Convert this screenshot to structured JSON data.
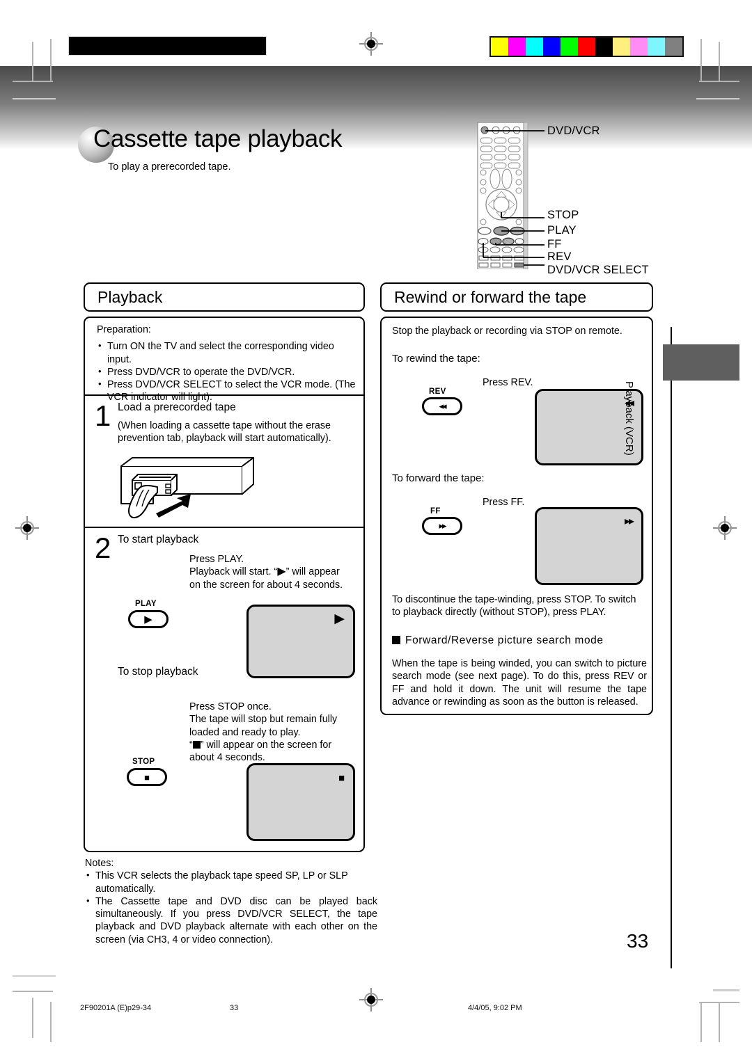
{
  "page": {
    "number": "33",
    "side_tab": "Playback (VCR)",
    "footer_left": "2F90201A (E)p29-34",
    "footer_center": "33",
    "footer_right": "4/4/05, 9:02 PM"
  },
  "heading": {
    "title": "Cassette tape playback",
    "subtitle": "To play a prerecorded tape."
  },
  "remote": {
    "callouts": [
      "DVD/VCR",
      "STOP",
      "PLAY",
      "FF",
      "REV",
      "DVD/VCR SELECT"
    ]
  },
  "playback": {
    "header": "Playback",
    "preparation_label": "Preparation:",
    "preparation_items": [
      "Turn ON the TV and select the corresponding video input.",
      "Press DVD/VCR to operate the DVD/VCR.",
      "Press DVD/VCR SELECT to select the VCR mode. (The VCR indicator will light)."
    ],
    "step1": {
      "num": "1",
      "title": "Load a prerecorded tape",
      "body": "(When loading a cassette tape without the erase prevention tab, playback will start automatically)."
    },
    "step2": {
      "num": "2",
      "title": "To start playback",
      "line1": "Press PLAY.",
      "line2a": "Playback will start. “",
      "line2icon": "▶",
      "line2b": "” will appear",
      "line3": "on the screen for about 4 seconds.",
      "button_label": "PLAY",
      "button_icon": "▶",
      "screen_icon": "▶"
    },
    "stop": {
      "title": "To stop playback",
      "line1": "Press STOP once.",
      "line2": "The tape will stop but remain fully",
      "line3": "loaded and ready to play.",
      "line4a": "“",
      "line4b": "” will appear on the screen for",
      "line5": "about 4 seconds.",
      "button_label": "STOP",
      "button_icon": "■",
      "screen_icon": "■"
    },
    "notes_label": "Notes:",
    "notes": [
      "This VCR selects the playback tape speed SP, LP or SLP automatically.",
      "The Cassette tape and DVD disc can be played back simultaneously. If you press DVD/VCR SELECT, the tape playback and DVD playback alternate with each other on the screen (via CH3, 4 or video connection)."
    ]
  },
  "rewind": {
    "header": "Rewind or forward the tape",
    "intro": "Stop the playback or recording via STOP on remote.",
    "rewind_label": "To rewind the tape:",
    "rewind_press": "Press REV.",
    "rewind_button_label": "REV",
    "rewind_button_icon": "◂◂",
    "rewind_screen_icon": "◂◂",
    "forward_label": "To forward the tape:",
    "forward_press": "Press FF.",
    "forward_button_label": "FF",
    "forward_button_icon": "▸▸",
    "forward_screen_icon": "▸▸",
    "discontinue": "To discontinue the tape-winding, press STOP. To switch to playback directly (without STOP), press PLAY.",
    "search_heading": "Forward/Reverse picture search mode",
    "search_body": "When the tape is being winded, you can switch to picture search mode (see next page). To do this, press REV or FF and hold it down. The unit will resume the tape advance or rewinding as soon as the button is released."
  },
  "colorbar": [
    "#ffff00",
    "#ff00ff",
    "#00ffff",
    "#0000ff",
    "#00ff00",
    "#ff0000",
    "#000000",
    "#ffef7f",
    "#ff8cf5",
    "#7ff5ff",
    "#808080"
  ]
}
